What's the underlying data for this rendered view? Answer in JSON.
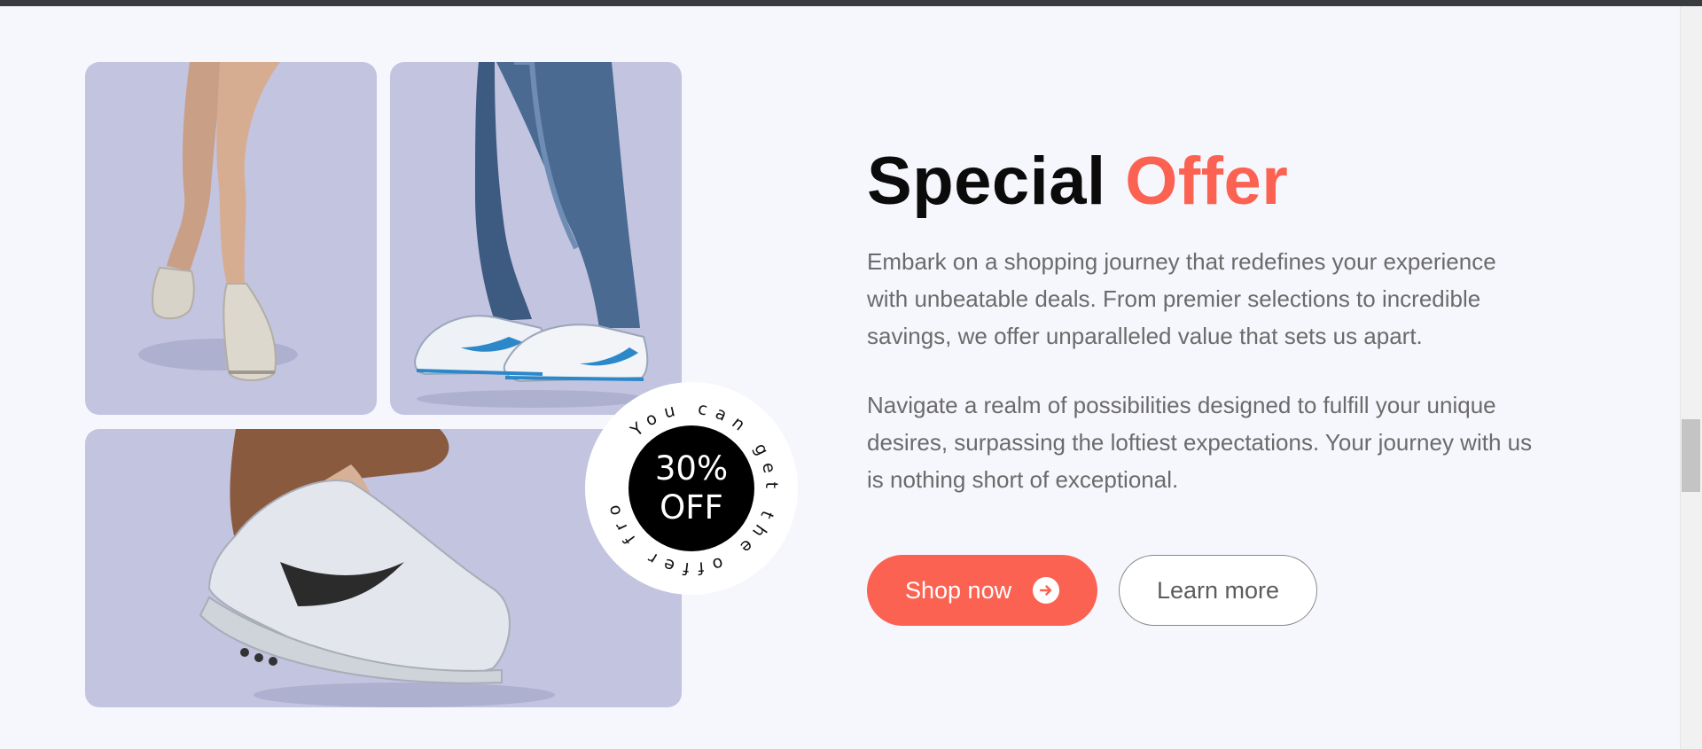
{
  "offer": {
    "title_main": "Special",
    "title_accent": "Offer",
    "paragraph_1": "Embark on a shopping journey that redefines your experience with unbeatable deals. From premier selections to incredible savings, we offer unparalleled value that sets us apart.",
    "paragraph_2": "Navigate a realm of possibilities designed to fulfill your unique desires, surpassing the loftiest expectations. Your journey with us is nothing short of exceptional."
  },
  "badge": {
    "ring_text": "You can get the offer from Nike",
    "percent": "30%",
    "off": "OFF"
  },
  "buttons": {
    "primary_label": "Shop now",
    "primary_icon": "arrow-right-circle-icon",
    "secondary_label": "Learn more"
  },
  "gallery": {
    "tile_background": "#c2c4e0",
    "images": [
      "crossed-legs-sneakers-image",
      "jeans-blue-sneakers-image",
      "grey-sneaker-jump-image"
    ]
  },
  "colors": {
    "accent": "#fb6251",
    "page_background": "#f6f6fd",
    "heading": "#0b0b0b",
    "body_text": "#6b6b6b"
  }
}
